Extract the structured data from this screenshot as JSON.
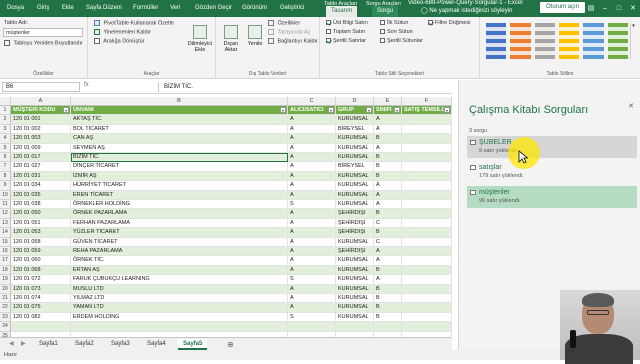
{
  "titlebar": {
    "file_tab": "Dosya",
    "tabs": [
      "Giriş",
      "Ekle",
      "Sayfa Düzeni",
      "Formüller",
      "Veri",
      "Gözden Geçir",
      "Görünüm",
      "Geliştirici"
    ],
    "context_groups": [
      "Tablo Araçları",
      "Sorgu Araçları"
    ],
    "context_tabs": [
      "Tasarım",
      "Sorgu"
    ],
    "search_hint": "Ne yapmak istediğinizi söyleyin",
    "window_title": "Video-689-Power-Query-Sorgular-1 - Excel",
    "signin": "Oturum açın",
    "colors": {
      "brand": "#217346",
      "table_header": "#70ad47",
      "band": "#e2efda"
    }
  },
  "ribbon": {
    "properties": {
      "name_label": "Tablo Adı:",
      "name_value": "müşteriler",
      "resize_label": "Tabloyu Yeniden Boyutlandır",
      "group_label": "Özellikler"
    },
    "tools": {
      "pivot": "PivotTable Kullanarak Özetle",
      "dup": "Yinelenenleri Kaldır",
      "convert": "Aralığa Dönüştür",
      "slicer": "Dilimleyici Ekle",
      "group_label": "Araçlar"
    },
    "external": {
      "export": "Dışarı Aktar",
      "refresh": "Yenile",
      "props": "Özellikler",
      "open_browser": "Tarayıcıda Aç",
      "unlink": "Bağlantıyı Kaldır",
      "group_label": "Dış Tablo Verileri"
    },
    "style_options": {
      "header_row": "Üst Bilgi Satırı",
      "total_row": "Toplam Satırı",
      "banded_rows": "Şeritli Satırlar",
      "first_col": "İlk Sütun",
      "last_col": "Son Sütun",
      "banded_cols": "Şeritli Sütunlar",
      "filter_btn": "Filtre Düğmesi",
      "group_label": "Tablo Stili Seçenekleri"
    },
    "styles_group_label": "Tablo Stilleri"
  },
  "formula": {
    "name_box": "B6",
    "fx": "fx",
    "value": "BİZİM TİC."
  },
  "grid": {
    "columns": [
      "A",
      "B",
      "C",
      "D",
      "E",
      "F"
    ],
    "headers": [
      "MÜŞTERİ KODU",
      "ÜNVANI",
      "ALICI/SATICI",
      "GRUP",
      "SINIFI",
      "SATIŞ TEMSİLC"
    ],
    "row_numbers": [
      "1",
      "2",
      "3",
      "4",
      "5",
      "6",
      "7",
      "8",
      "9",
      "10",
      "11",
      "12",
      "13",
      "14",
      "15",
      "16",
      "17",
      "18",
      "19",
      "20",
      "21",
      "22",
      "23",
      "24",
      "25"
    ],
    "rows": [
      [
        "120 01 001",
        "AKTAŞ TİC.",
        "A",
        "KURUMSAL",
        "A"
      ],
      [
        "120 01 002",
        "BOL TİCARET",
        "A",
        "BİREYSEL",
        "A"
      ],
      [
        "120 01 003",
        "CAN AŞ",
        "A",
        "KURUMSAL",
        "B"
      ],
      [
        "120 01 009",
        "SEYMEN AŞ",
        "A",
        "KURUMSAL",
        "A"
      ],
      [
        "120 01 017",
        "BİZİM TİC.",
        "A",
        "KURUMSAL",
        "B"
      ],
      [
        "120 01 027",
        "DİNÇER TİCARET",
        "A",
        "BİREYSEL",
        "B"
      ],
      [
        "120 01 031",
        "İZMİR AŞ",
        "A",
        "KURUMSAL",
        "B"
      ],
      [
        "120 01 034",
        "HÜRRİYET TİCARET",
        "A",
        "KURUMSAL",
        "A"
      ],
      [
        "120 01 035",
        "EREN TİCARET",
        "A",
        "KURUMSAL",
        "A"
      ],
      [
        "120 01 038",
        "ÖRNEKLER HOLDİNG",
        "S",
        "KURUMSAL",
        "A"
      ],
      [
        "120 01 050",
        "ÖRNEK PAZARLAMA",
        "A",
        "ŞEHİRDIŞI",
        "B"
      ],
      [
        "120 01 051",
        "FERHAN PAZARLAMA",
        "A",
        "ŞEHİRDIŞI",
        "C"
      ],
      [
        "120 01 053",
        "YÜZLER TİCARET",
        "A",
        "ŞEHİRDIŞI",
        "B"
      ],
      [
        "120 01 058",
        "GÜVEN TİCARET",
        "A",
        "KURUMSAL",
        "C"
      ],
      [
        "120 01 059",
        "REHA PAZARLAMA",
        "A",
        "ŞEHİRDIŞI",
        "A"
      ],
      [
        "120 01 060",
        "ÖRNEK TİC.",
        "A",
        "KURUMSAL",
        "A"
      ],
      [
        "120 01 068",
        "ERTAN AŞ",
        "A",
        "KURUMSAL",
        "B"
      ],
      [
        "120 01 072",
        "FARUK ÇUBUKÇU LEARNING",
        "S",
        "KURUMSAL",
        "A"
      ],
      [
        "120 01 073",
        "MUSLU LTD",
        "A",
        "KURUMSAL",
        "B"
      ],
      [
        "120 01 074",
        "YILMAZ LTD",
        "A",
        "KURUMSAL",
        "B"
      ],
      [
        "120 01 075",
        "YAMAN LTD",
        "A",
        "KURUMSAL",
        "B"
      ],
      [
        "120 01 082",
        "ERDEM HOLDİNG",
        "S",
        "KURUMSAL",
        "B"
      ]
    ]
  },
  "sheets": {
    "tabs": [
      "Sayfa1",
      "Sayfa2",
      "Sayfa3",
      "Sayfa4",
      "Sayfa5"
    ],
    "active": "Sayfa5"
  },
  "status": {
    "text": "Hazır"
  },
  "pane": {
    "title": "Çalışma Kitabı Sorguları",
    "count": "3 sorgu",
    "queries": [
      {
        "name": "ŞUBELER",
        "meta": "9 satır yüklendi."
      },
      {
        "name": "satışlar",
        "meta": "179 satır yüklendi."
      },
      {
        "name": "müşteriler",
        "meta": "96 satır yüklendi."
      }
    ]
  }
}
